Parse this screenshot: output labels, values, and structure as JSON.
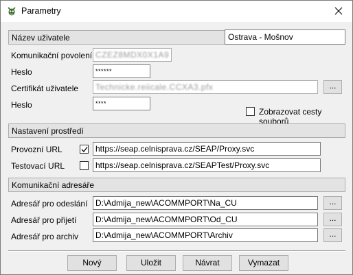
{
  "window": {
    "title": "Parametry"
  },
  "user_section": {
    "header": "Název uživatele",
    "user_name_value": "Ostrava - Mošnov",
    "komunikacni_povoleni_label": "Komunikační povolení",
    "komunikacni_povoleni_value": "CZEZ8MDX0X1A9",
    "heslo1_label": "Heslo",
    "heslo1_value": "******",
    "certifikat_label": "Certifikát uživatele",
    "certifikat_value": "Technicke.reiicale.CCXA3.pfx",
    "browse_label": "...",
    "heslo2_label": "Heslo",
    "heslo2_value": "****",
    "show_paths_label": "Zobrazovat cesty souborů",
    "show_paths_checked": false
  },
  "env_section": {
    "header": "Nastavení prostředí",
    "provozni_label": "Provozní URL",
    "provozni_checked": true,
    "provozni_url": "https://seap.celnisprava.cz/SEAP/Proxy.svc",
    "testovaci_label": "Testovací URL",
    "testovaci_checked": false,
    "testovaci_url": "https://seap.celnisprava.cz/SEAPTest/Proxy.svc"
  },
  "dirs_section": {
    "header": "Komunikační adresáře",
    "odeslani_label": "Adresář pro odeslání",
    "odeslani_path": "D:\\Admija_new\\ACOMMPORT\\Na_CU",
    "prijeti_label": "Adresář pro přijetí",
    "prijeti_path": "D:\\Admija_new\\ACOMMPORT\\Od_CU",
    "archiv_label": "Adresář pro archiv",
    "archiv_path": "D:\\Admija_new\\ACOMMPORT\\Archiv",
    "browse_label": "..."
  },
  "buttons": {
    "new": "Nový",
    "save": "Uložit",
    "back": "Návrat",
    "clear": "Vymazat"
  },
  "icons": {
    "app": "app-icon",
    "close": "close-icon",
    "check": "checkmark-icon"
  }
}
